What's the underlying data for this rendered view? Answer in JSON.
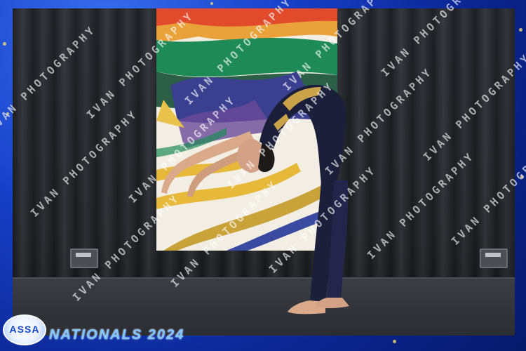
{
  "watermark": {
    "text": "IVAN PHOTOGRAPHY"
  },
  "logo": {
    "text": "ASSA"
  },
  "event": {
    "title": "NATIONALS 2024"
  },
  "colors": {
    "frame_blue": "#1740c8",
    "title_blue": "#7fc7ff",
    "costume": "#1c1f3a"
  }
}
